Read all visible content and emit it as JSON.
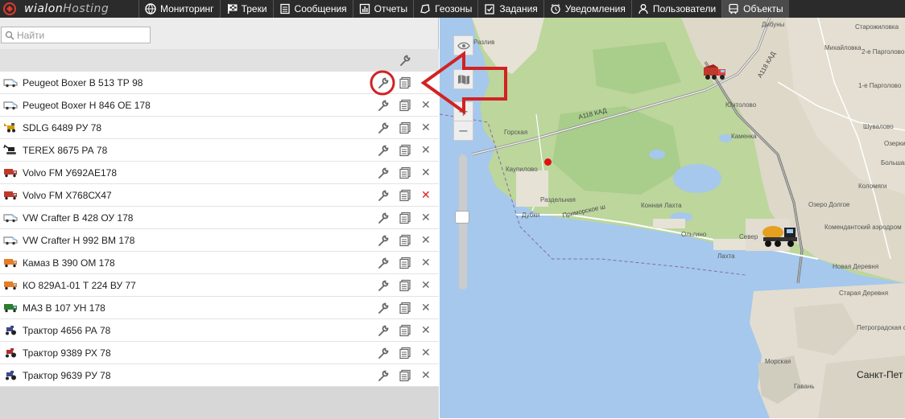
{
  "app": {
    "logo_main": "wialon",
    "logo_sub": "Hosting"
  },
  "nav": [
    {
      "label": "Мониторинг",
      "icon": "globe-icon"
    },
    {
      "label": "Треки",
      "icon": "checkered-flag-icon"
    },
    {
      "label": "Сообщения",
      "icon": "messages-icon"
    },
    {
      "label": "Отчеты",
      "icon": "chart-icon"
    },
    {
      "label": "Геозоны",
      "icon": "geozone-icon"
    },
    {
      "label": "Задания",
      "icon": "tasks-icon"
    },
    {
      "label": "Уведомления",
      "icon": "alarm-icon"
    },
    {
      "label": "Пользователи",
      "icon": "user-icon"
    },
    {
      "label": "Объекты",
      "icon": "bus-icon",
      "active": true
    }
  ],
  "search": {
    "placeholder": "Найти",
    "value": ""
  },
  "units": [
    {
      "name": "Peugeot Boxer В 513 ТР 98",
      "type": "van",
      "color": "#888888",
      "delete": "none"
    },
    {
      "name": "Peugeot Boxer Н 846 ОЕ 178",
      "type": "van",
      "color": "#888888",
      "delete": "gray"
    },
    {
      "name": "SDLG 6489 РУ 78",
      "type": "loader",
      "color": "#d49a00",
      "delete": "gray"
    },
    {
      "name": "TEREX 8675 РА 78",
      "type": "excavator",
      "color": "#222222",
      "delete": "gray"
    },
    {
      "name": "Volvo FM У692АЕ178",
      "type": "truck",
      "color": "#c0392b",
      "delete": "gray"
    },
    {
      "name": "Volvo FM Х768СХ47",
      "type": "truck",
      "color": "#c0392b",
      "delete": "red"
    },
    {
      "name": "VW Crafter В 428 ОУ 178",
      "type": "van",
      "color": "#888888",
      "delete": "gray"
    },
    {
      "name": "VW Crafter Н 992 ВМ 178",
      "type": "van",
      "color": "#888888",
      "delete": "gray"
    },
    {
      "name": "Камаз В 390 ОМ 178",
      "type": "truck",
      "color": "#e67e22",
      "delete": "gray"
    },
    {
      "name": "КО 829А1-01 Т 224 ВУ 77",
      "type": "truck",
      "color": "#e67e22",
      "delete": "gray"
    },
    {
      "name": "МАЗ В 107 УН 178",
      "type": "truck",
      "color": "#2e7d32",
      "delete": "gray"
    },
    {
      "name": "Трактор 4656 РА 78",
      "type": "tractor",
      "color": "#3d4a8a",
      "delete": "gray"
    },
    {
      "name": "Трактор 9389 РХ 78",
      "type": "tractor",
      "color": "#b03030",
      "delete": "gray"
    },
    {
      "name": "Трактор 9639 РУ 78",
      "type": "tractor",
      "color": "#3d4a8a",
      "delete": "gray"
    }
  ],
  "map": {
    "labels": {
      "razliv": "Разлив",
      "kad_top": "А118 КАД",
      "kad_mid": "А118 КАД",
      "gorskaya": "Горская",
      "kaupilovo": "Каупилово",
      "razdelnaya": "Раздельная",
      "dubki": "Дубки",
      "primorskoe": "Приморское ш",
      "konnaya": "Конная Лахта",
      "olgino": "Ольгино",
      "lakhta": "Лахта",
      "kamenka": "Каменка",
      "ozero_dolgoe": "Озеро Долгое",
      "komendantsky": "Комендантский аэродром",
      "novaya_derevnya": "Новая Деревня",
      "staraya_derevnya": "Старая Деревня",
      "severny": "Север",
      "morskaya": "Морская",
      "gavan": "Гавань",
      "spb": "Санкт-Пет",
      "petrogradskaya": "Петроградская сто",
      "starozhilovka": "Старожиловка",
      "mikhailovka": "Михайловка",
      "pargolovo2": "2-е Парголово",
      "pargolovo1": "1-е Парголово",
      "shuvalovo": "Шувалово",
      "ozerki": "Озерки",
      "kolomyagi": "Коломяги",
      "bolshaya": "Большая",
      "dibuny": "Дибуны",
      "yuntolovo": "Юнтолово"
    }
  },
  "colors": {
    "accent": "#d22222",
    "nav_bg": "#2b2b2b",
    "water": "#a5c8ec",
    "land": "#b9d49a"
  }
}
